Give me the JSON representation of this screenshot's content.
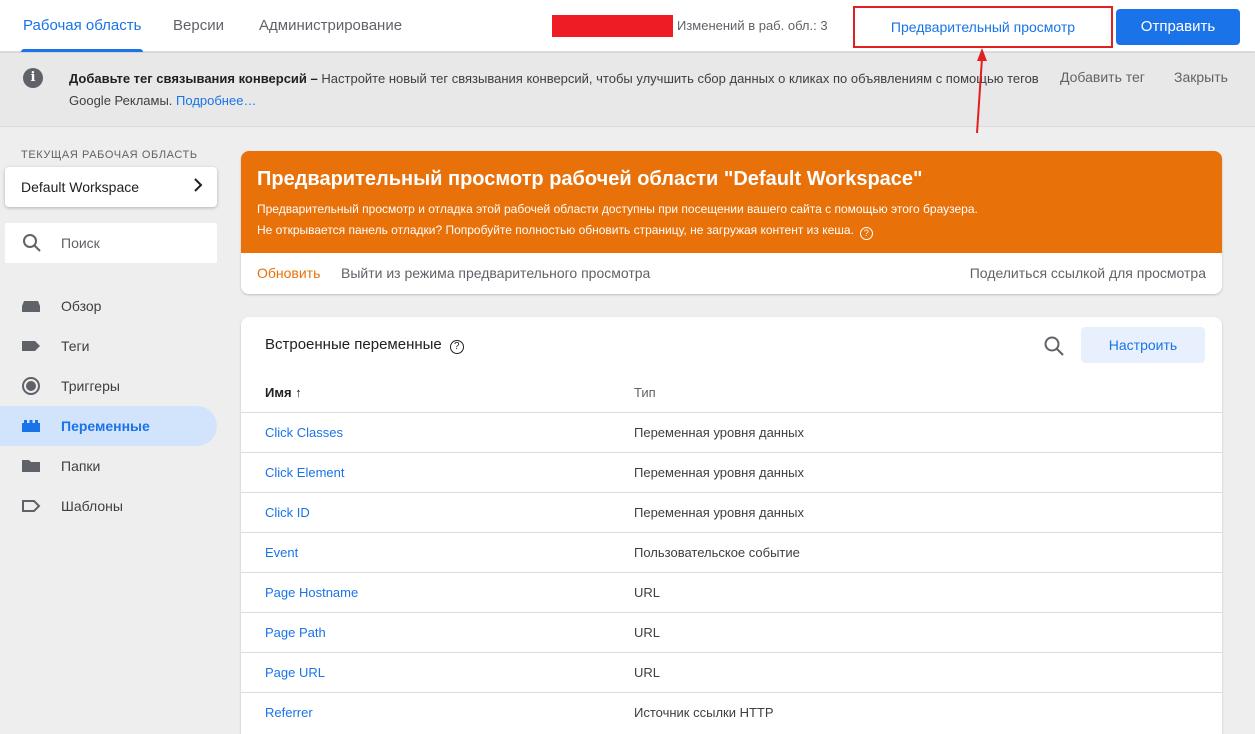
{
  "topbar": {
    "tabs": [
      {
        "label": "Рабочая область",
        "active": true
      },
      {
        "label": "Версии",
        "active": false
      },
      {
        "label": "Администрирование",
        "active": false
      }
    ],
    "changes_text": "Изменений в раб. обл.: 3",
    "preview_label": "Предварительный просмотр",
    "submit_label": "Отправить"
  },
  "notice": {
    "icon": "info-icon",
    "bold_text": "Добавьте тег связывания конверсий –",
    "text": "Настройте новый тег связывания конверсий, чтобы улучшить сбор данных о кликах по объявлениям с помощью тегов Google Рекламы.",
    "link": "Подробнее…",
    "add_label": "Добавить тег",
    "close_label": "Закрыть"
  },
  "sidebar": {
    "workspace_label": "ТЕКУЩАЯ РАБОЧАЯ ОБЛАСТЬ",
    "workspace_name": "Default Workspace",
    "search_placeholder": "Поиск",
    "items": [
      {
        "label": "Обзор",
        "icon": "overview-icon",
        "active": false
      },
      {
        "label": "Теги",
        "icon": "tag-icon",
        "active": false
      },
      {
        "label": "Триггеры",
        "icon": "trigger-icon",
        "active": false
      },
      {
        "label": "Переменные",
        "icon": "variables-icon",
        "active": true
      },
      {
        "label": "Папки",
        "icon": "folder-icon",
        "active": false
      },
      {
        "label": "Шаблоны",
        "icon": "template-icon",
        "active": false
      }
    ]
  },
  "preview_card": {
    "title": "Предварительный просмотр рабочей области \"Default Workspace\"",
    "line1": "Предварительный просмотр и отладка этой рабочей области доступны при посещении вашего сайта с помощью этого браузера.",
    "line2": "Не открывается панель отладки? Попробуйте полностью обновить страницу, не загружая контент из кеша.",
    "refresh_label": "Обновить",
    "exit_label": "Выйти из режима предварительного просмотра",
    "share_label": "Поделиться ссылкой для просмотра",
    "accent": "#e8710a"
  },
  "variables": {
    "title": "Встроенные переменные",
    "configure_label": "Настроить",
    "col_name": "Имя",
    "col_type": "Тип",
    "rows": [
      {
        "name": "Click Classes",
        "type": "Переменная уровня данных"
      },
      {
        "name": "Click Element",
        "type": "Переменная уровня данных"
      },
      {
        "name": "Click ID",
        "type": "Переменная уровня данных"
      },
      {
        "name": "Event",
        "type": "Пользовательское событие"
      },
      {
        "name": "Page Hostname",
        "type": "URL"
      },
      {
        "name": "Page Path",
        "type": "URL"
      },
      {
        "name": "Page URL",
        "type": "URL"
      },
      {
        "name": "Referrer",
        "type": "Источник ссылки HTTP"
      }
    ]
  },
  "colors": {
    "brand": "#1a73e8",
    "highlight": "#e02020"
  }
}
